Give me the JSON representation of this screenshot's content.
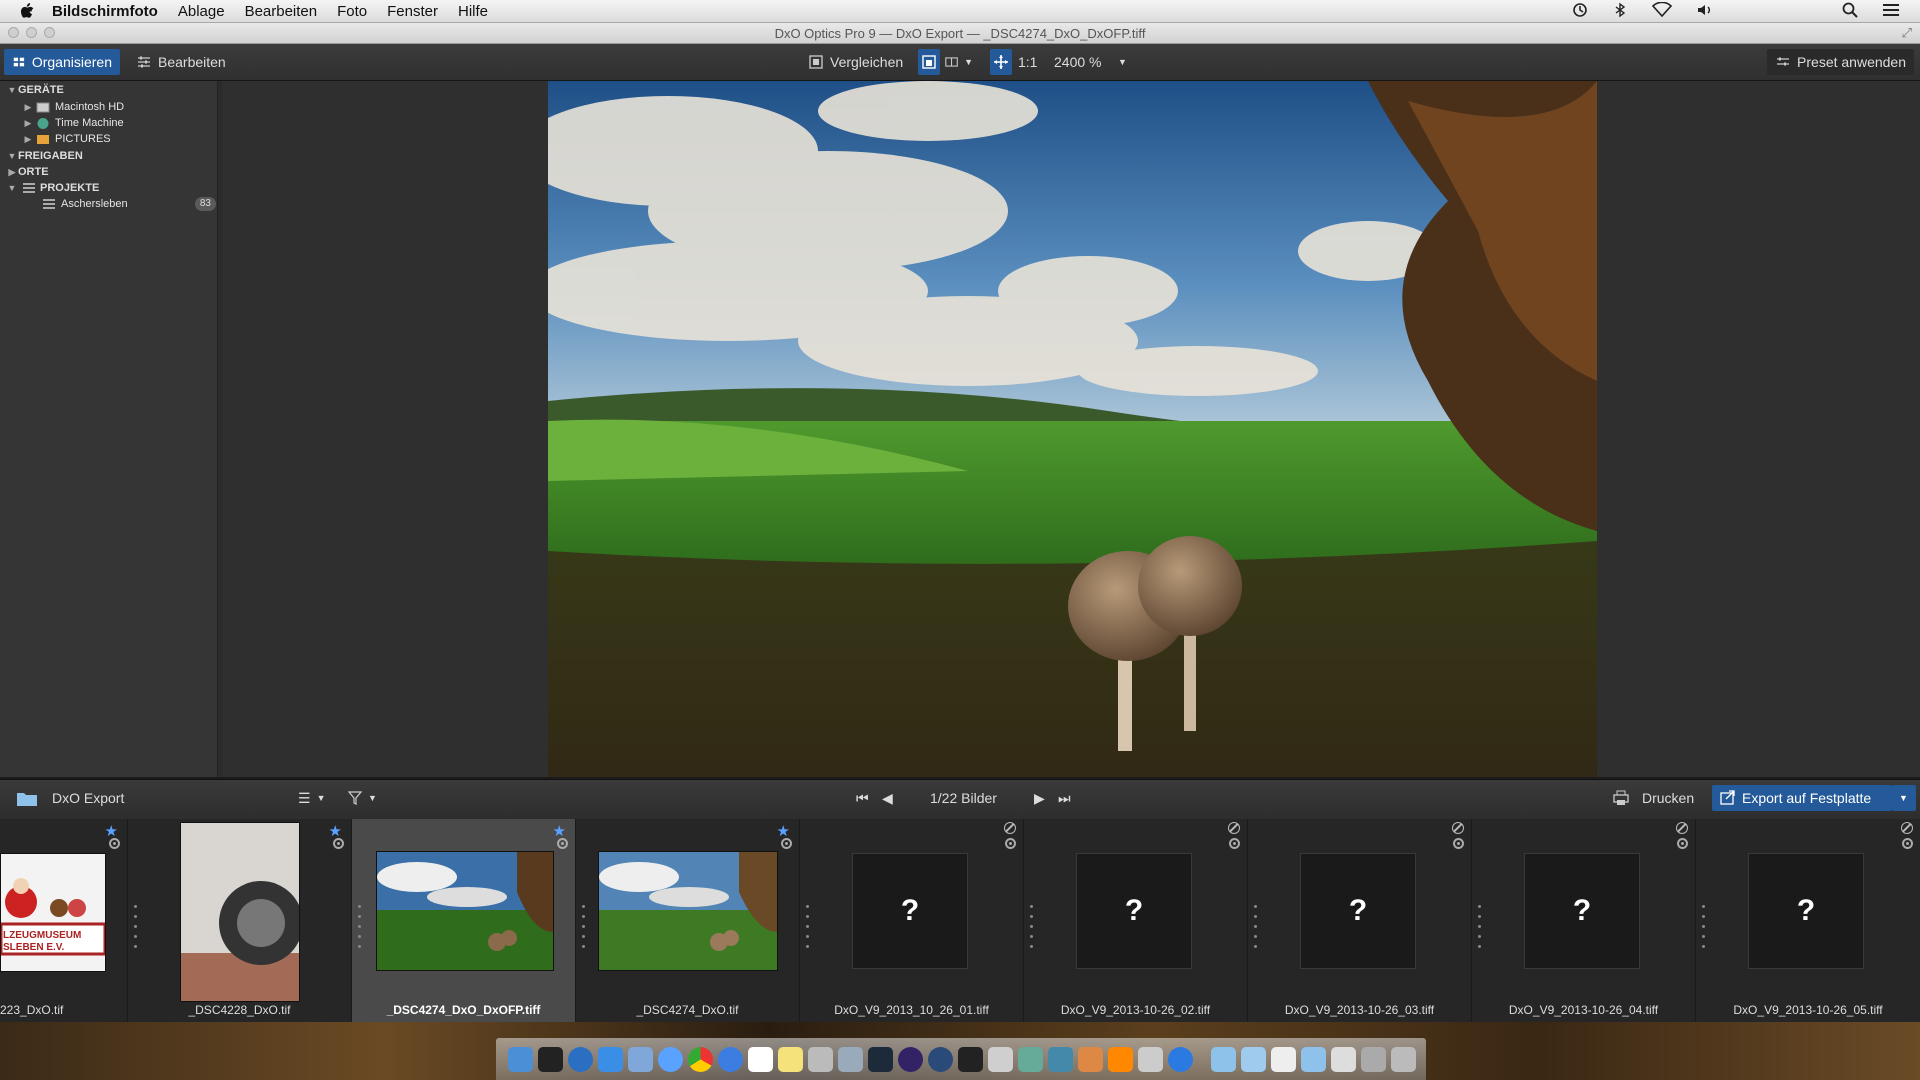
{
  "menubar": {
    "app": "Bildschirmfoto",
    "items": [
      "Ablage",
      "Bearbeiten",
      "Foto",
      "Fenster",
      "Hilfe"
    ]
  },
  "window": {
    "title": "DxO Optics Pro 9 — DxO Export — _DSC4274_DxO_DxOFP.tiff"
  },
  "toolbar": {
    "organize": "Organisieren",
    "edit": "Bearbeiten",
    "compare": "Vergleichen",
    "ratio": "1:1",
    "zoom": "2400 %",
    "apply_preset": "Preset anwenden"
  },
  "sidebar": {
    "devices_header": "GERÄTE",
    "devices": [
      "Macintosh HD",
      "Time Machine",
      "PICTURES"
    ],
    "shares_header": "FREIGABEN",
    "places_header": "ORTE",
    "projects_header": "PROJEKTE",
    "project_name": "Aschersleben",
    "project_count": "83"
  },
  "filmstrip": {
    "folder": "DxO Export",
    "counter": "1/22 Bilder",
    "print": "Drucken",
    "export": "Export auf Festplatte",
    "partial_thumb_text_1": "LZEUGMUSEUM",
    "partial_thumb_text_2": "SLEBEN  E.V.",
    "placeholder_mark": "?",
    "files": [
      "223_DxO.tif",
      "_DSC4228_DxO.tif",
      "_DSC4274_DxO_DxOFP.tiff",
      "_DSC4274_DxO.tif",
      "DxO_V9_2013_10_26_01.tiff",
      "DxO_V9_2013-10-26_02.tiff",
      "DxO_V9_2013-10-26_03.tiff",
      "DxO_V9_2013-10-26_04.tiff",
      "DxO_V9_2013-10-26_05.tiff"
    ]
  },
  "colors": {
    "accent": "#245a99",
    "star": "#5aa2ff",
    "panel": "#353535"
  }
}
